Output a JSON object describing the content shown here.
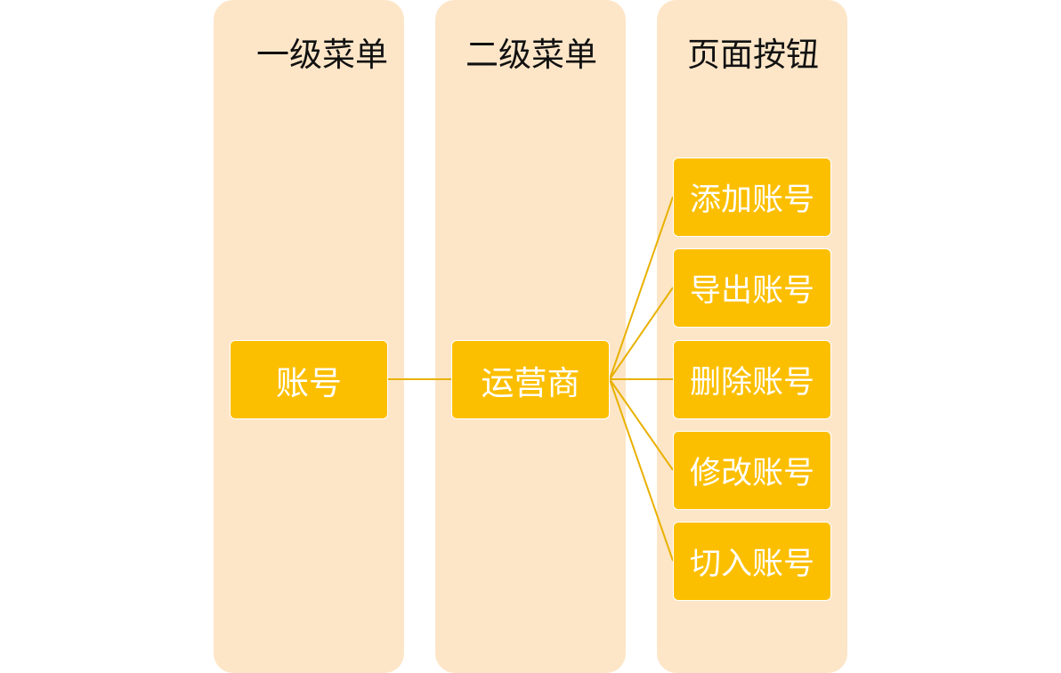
{
  "columns": {
    "level1": {
      "title": "一级菜单"
    },
    "level2": {
      "title": "二级菜单"
    },
    "buttons": {
      "title": "页面按钮"
    }
  },
  "nodes": {
    "level1": {
      "label": "账号"
    },
    "level2": {
      "label": "运营商"
    },
    "buttons": [
      {
        "label": "添加账号"
      },
      {
        "label": "导出账号"
      },
      {
        "label": "删除账号"
      },
      {
        "label": "修改账号"
      },
      {
        "label": "切入账号"
      }
    ]
  },
  "colors": {
    "column_background": "#fde6c8",
    "node_fill": "#fcbf00",
    "node_text": "#ffffff",
    "connector": "#e9b100",
    "title_text": "#111111"
  }
}
